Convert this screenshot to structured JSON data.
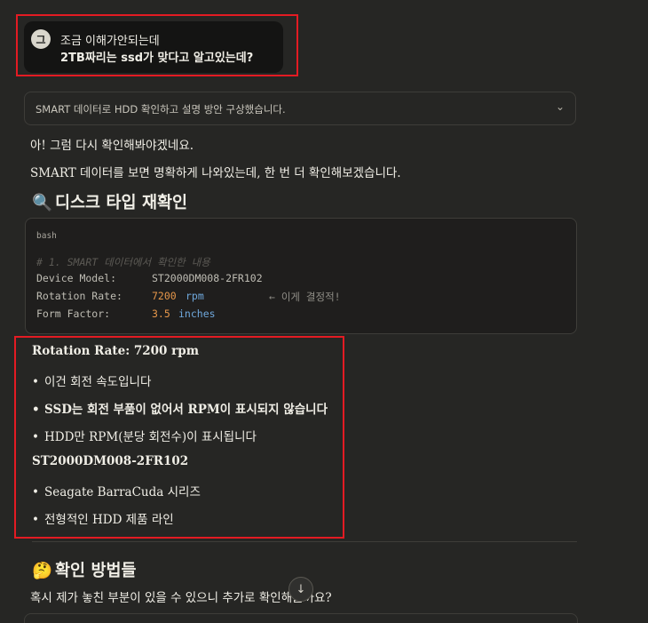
{
  "user_message": {
    "avatar": "그",
    "line1": "조금 이해가안되는데",
    "line2": "2TB짜리는 ssd가 맞다고 알고있는데?"
  },
  "thinking": {
    "label": "SMART 데이터로 HDD 확인하고 설명 방안 구상했습니다.",
    "icon": "chevron-down-icon"
  },
  "response": {
    "para1": "아! 그럼 다시 확인해봐야겠네요.",
    "para2": "SMART 데이터를 보면 명확하게 나와있는데, 한 번 더 확인해보겠습니다.",
    "heading1": {
      "icon": "🔍",
      "text": "디스크 타입 재확인"
    },
    "code": {
      "lang": "bash",
      "comment": "# 1. SMART 데이터에서 확인한 내용",
      "model_key": "Device Model:",
      "model_val": "ST2000DM008-2FR102",
      "rpm_key": "Rotation Rate:",
      "rpm_num": "7200",
      "rpm_unit": "rpm",
      "rpm_note": "← 이게 결정적!",
      "ff_key": "Form Factor:",
      "ff_num": "3.5",
      "ff_unit": "inches"
    },
    "section1_title": "Rotation Rate: 7200 rpm",
    "section1_bullets": [
      "이건 회전 속도입니다",
      "SSD는 회전 부품이 없어서 RPM이 표시되지 않습니다",
      "HDD만 RPM(분당 회전수)이 표시됩니다"
    ],
    "section2_title": "ST2000DM008-2FR102",
    "section2_bullets": [
      "Seagate BarraCuda 시리즈",
      "전형적인 HDD 제품 라인"
    ],
    "heading2": {
      "icon": "🤔",
      "text": "확인 방법들"
    },
    "para3": "혹시 제가 놓친 부분이 있을 수 있으니 추가로 확인해볼까요?"
  },
  "scroll_button": {
    "icon": "↓"
  },
  "colors": {
    "background": "#262624",
    "highlight": "#e31b23",
    "number": "#e6974a",
    "unit": "#6fa8dc"
  }
}
